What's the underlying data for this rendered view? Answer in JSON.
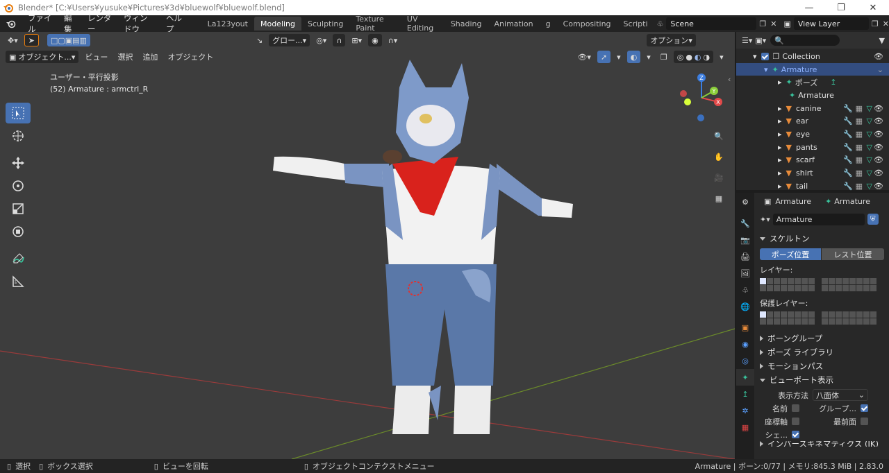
{
  "window": {
    "title": "Blender* [C:¥Users¥yusuke¥Pictures¥3d¥bluewolf¥bluewolf.blend]"
  },
  "menu": {
    "items": [
      "ファイル",
      "編集",
      "レンダー",
      "ウィンドウ",
      "ヘルプ"
    ]
  },
  "workspaces": {
    "tabs": [
      "La123yout",
      "Modeling",
      "Sculpting",
      "Texture Paint",
      "UV Editing",
      "Shading",
      "Animation",
      "g",
      "Compositing",
      "Scripti"
    ],
    "active": "Modeling"
  },
  "scene": {
    "name": "Scene"
  },
  "view_layer": {
    "name": "View Layer"
  },
  "viewport": {
    "mode_label": "オブジェクト...",
    "header_menus": [
      "ビュー",
      "選択",
      "追加",
      "オブジェクト"
    ],
    "transform_orientation": "グロー...",
    "options_label": "オプション",
    "info_line1": "ユーザー・平行投影",
    "info_line2": "(52) Armature : armctrl_R",
    "gizmo_axes": [
      "X",
      "Y",
      "Z"
    ]
  },
  "outliner": {
    "search_placeholder": "",
    "collection": "Collection",
    "armature": "Armature",
    "pose": "ポーズ",
    "armature_data": "Armature",
    "meshes": [
      "canine",
      "ear",
      "eye",
      "pants",
      "scarf",
      "shirt",
      "tail"
    ]
  },
  "properties": {
    "breadcrumb_object": "Armature",
    "breadcrumb_data": "Armature",
    "datablock_name": "Armature",
    "skeleton_title": "スケルトン",
    "pose_position": "ポーズ位置",
    "rest_position": "レスト位置",
    "layers_label": "レイヤー:",
    "protected_layers_label": "保護レイヤー:",
    "bone_groups": "ボーングループ",
    "pose_library": "ポーズ ライブラリ",
    "motion_paths": "モーションパス",
    "viewport_display": "ビューポート表示",
    "display_as_label": "表示方法",
    "display_as_value": "八面体",
    "names_label": "名前",
    "group_label": "グループ...",
    "axes_label": "座標軸",
    "in_front_label": "最前面",
    "shapes_label": "シェ...",
    "next_panel": "インバースキネマティクス (IK)"
  },
  "status": {
    "select": "選択",
    "box_select": "ボックス選択",
    "rotate_view": "ビューを回転",
    "context_menu": "オブジェクトコンテクストメニュー",
    "stats": "Armature | ボーン:0/77 | メモリ:845.3 MiB | 2.83.0"
  },
  "colors": {
    "accent": "#4772b3",
    "viewport_bg": "#3d3d3d",
    "x_axis": "#e34a4a",
    "y_axis": "#8bcf3a",
    "z_axis": "#3b7de0",
    "mesh_icon": "#e88b3a",
    "bone_icon": "#39c39c"
  }
}
